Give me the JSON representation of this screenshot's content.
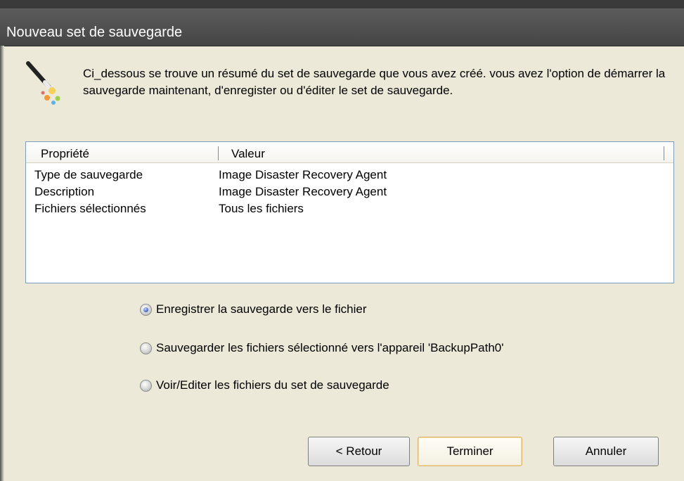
{
  "window": {
    "title": "Nouveau set de sauvegarde"
  },
  "description": "Ci_dessous se trouve un résumé du set de sauvegarde que vous avez créé. vous avez l'option de démarrer la sauvegarde maintenant, d'enregister ou d'éditer le set de sauvegarde.",
  "summary": {
    "columns": [
      "Propriété",
      "Valeur"
    ],
    "rows": [
      [
        "Type de sauvegarde",
        "Image Disaster Recovery Agent"
      ],
      [
        "Description",
        "Image Disaster Recovery Agent"
      ],
      [
        "Fichiers sélectionnés",
        "Tous les fichiers"
      ]
    ]
  },
  "options": [
    {
      "label": "Enregistrer la sauvegarde vers le fichier",
      "checked": true
    },
    {
      "label": "Sauvegarder les fichiers sélectionné vers l'appareil 'BackupPath0'",
      "checked": false
    },
    {
      "label": "Voir/Editer les fichiers du set de sauvegarde",
      "checked": false
    }
  ],
  "buttons": {
    "back": "< Retour",
    "finish": "Terminer",
    "cancel": "Annuler"
  },
  "icons": {
    "wizard": "magic-wand-icon"
  },
  "colors": {
    "title_bar": "#4f4f4f",
    "dialog_bg": "#ece9d8",
    "radio_selected": "#3a5fc2"
  }
}
